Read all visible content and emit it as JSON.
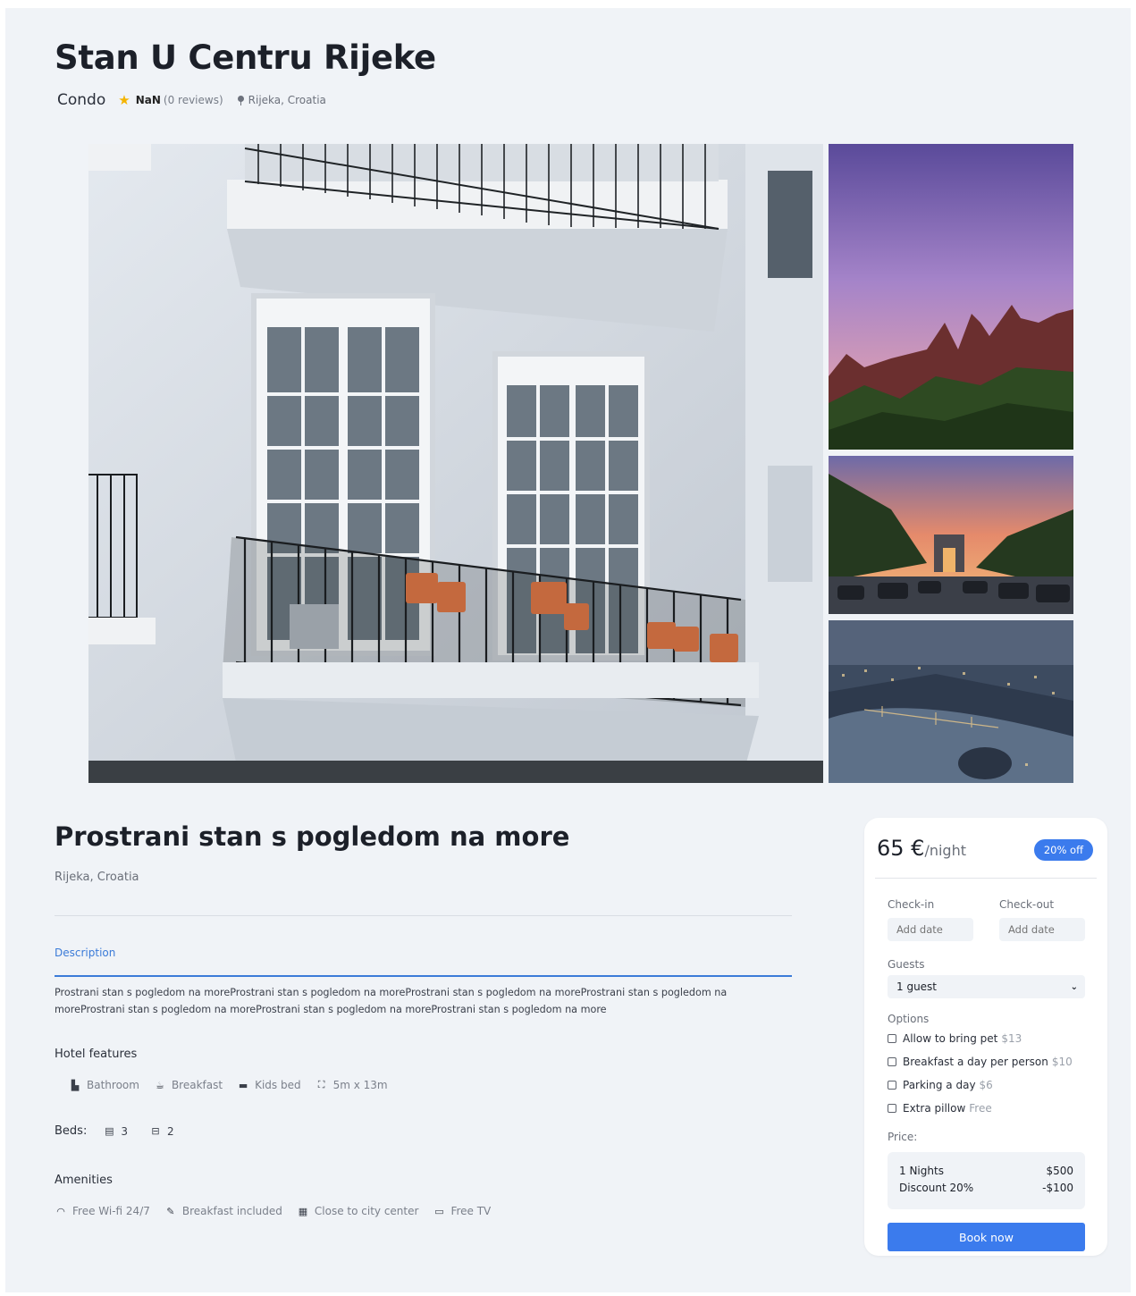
{
  "header": {
    "title": "Stan U Centru Rijeke",
    "type": "Condo",
    "rating": "NaN",
    "reviews": "(0 reviews)",
    "location": "Rijeka, Croatia"
  },
  "gallery": {
    "images": [
      "building-balconies-photo",
      "purple-sky-mountains-photo",
      "sunset-boulevard-arch-photo",
      "city-river-bridge-night-photo"
    ]
  },
  "listing": {
    "title": "Prostrani stan s pogledom na more",
    "location": "Rijeka, Croatia",
    "tab": "Description",
    "description": "Prostrani stan s pogledom na moreProstrani stan s pogledom na moreProstrani stan s pogledom na moreProstrani stan s pogledom na moreProstrani stan s pogledom na moreProstrani stan s pogledom na moreProstrani stan s pogledom na more"
  },
  "features": {
    "title": "Hotel features",
    "items": [
      {
        "icon": "bath-icon",
        "label": "Bathroom"
      },
      {
        "icon": "coffee-icon",
        "label": "Breakfast"
      },
      {
        "icon": "bed-icon",
        "label": "Kids bed"
      },
      {
        "icon": "expand-icon",
        "label": "5m x 13m"
      }
    ]
  },
  "beds": {
    "label": "Beds:",
    "items": [
      {
        "icon": "double-bed-icon",
        "count": "3"
      },
      {
        "icon": "single-bed-icon",
        "count": "2"
      }
    ]
  },
  "amenities": {
    "title": "Amenities",
    "items": [
      {
        "icon": "wifi-icon",
        "label": "Free Wi-fi 24/7"
      },
      {
        "icon": "utensils-icon",
        "label": "Breakfast included"
      },
      {
        "icon": "building-icon",
        "label": "Close to city center"
      },
      {
        "icon": "tv-icon",
        "label": "Free TV"
      }
    ]
  },
  "booking": {
    "price": "65 €",
    "unit": "/night",
    "badge": "20% off",
    "checkin_label": "Check-in",
    "checkout_label": "Check-out",
    "checkin_placeholder": "Add date",
    "checkout_placeholder": "Add date",
    "guests_label": "Guests",
    "guests_value": "1 guest",
    "options_label": "Options",
    "options": [
      {
        "label": "Allow to bring pet",
        "price": "$13"
      },
      {
        "label": "Breakfast a day per person",
        "price": "$10"
      },
      {
        "label": "Parking a day",
        "price": "$6"
      },
      {
        "label": "Extra pillow",
        "price": "Free"
      }
    ],
    "price_label": "Price:",
    "summary": [
      {
        "label": "1 Nights",
        "value": "$500"
      },
      {
        "label": "Discount 20%",
        "value": "-$100"
      }
    ],
    "button": "Book now"
  },
  "colors": {
    "accent": "#3b7bed",
    "background": "#f0f3f7",
    "star": "#f4b400"
  }
}
